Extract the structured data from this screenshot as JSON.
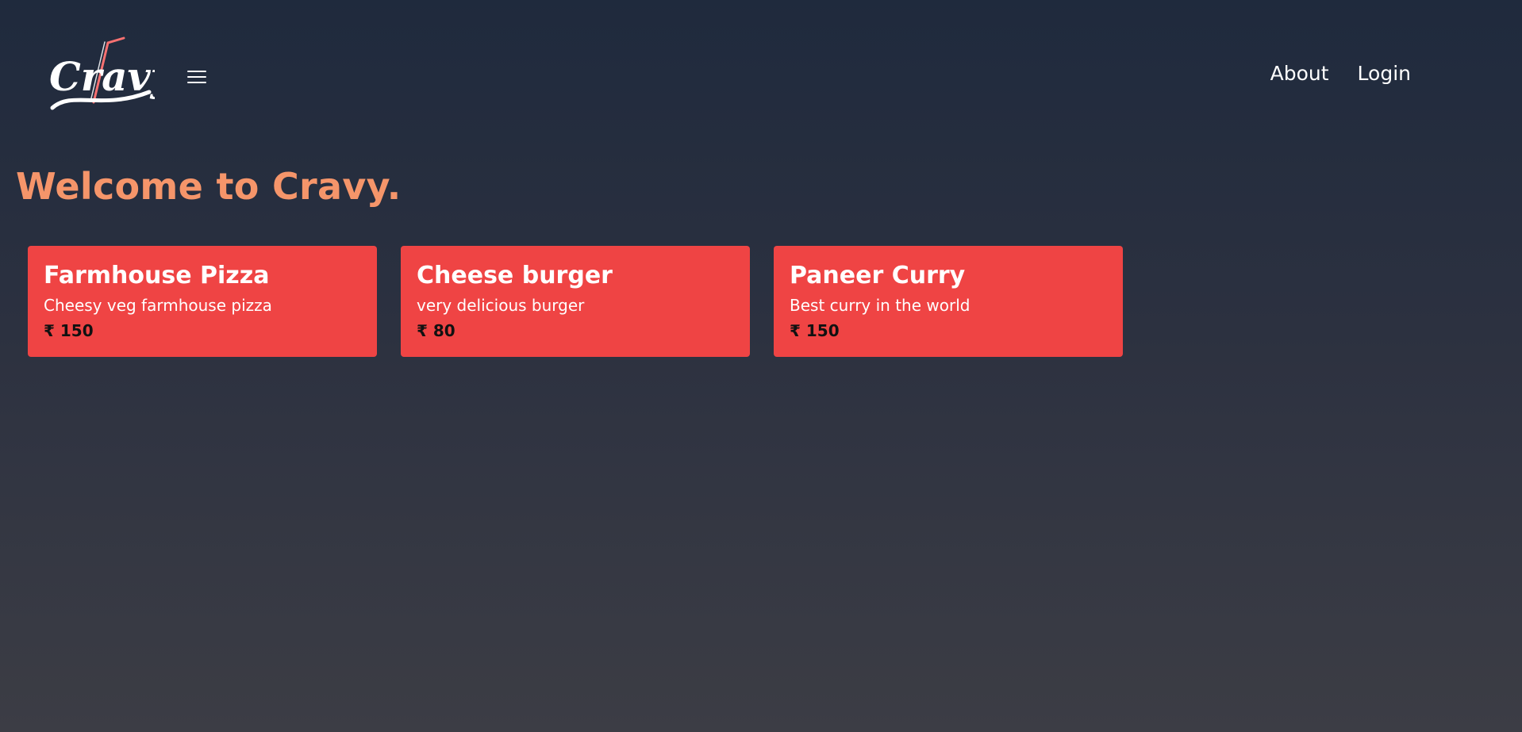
{
  "header": {
    "logo_text": "Cravy",
    "menu_icon": "hamburger-icon",
    "nav": [
      {
        "label": "About"
      },
      {
        "label": "Login"
      }
    ]
  },
  "main": {
    "welcome": "Welcome to Cravy.",
    "items": [
      {
        "title": "Farmhouse Pizza",
        "description": "Cheesy veg farmhouse pizza",
        "price": "₹ 150"
      },
      {
        "title": "Cheese burger",
        "description": "very delicious burger",
        "price": "₹ 80"
      },
      {
        "title": "Paneer Curry",
        "description": "Best curry in the world",
        "price": "₹ 150"
      }
    ]
  },
  "colors": {
    "accent": "#f5956a",
    "card": "#ef4444",
    "logo_straw": "#f87171"
  }
}
